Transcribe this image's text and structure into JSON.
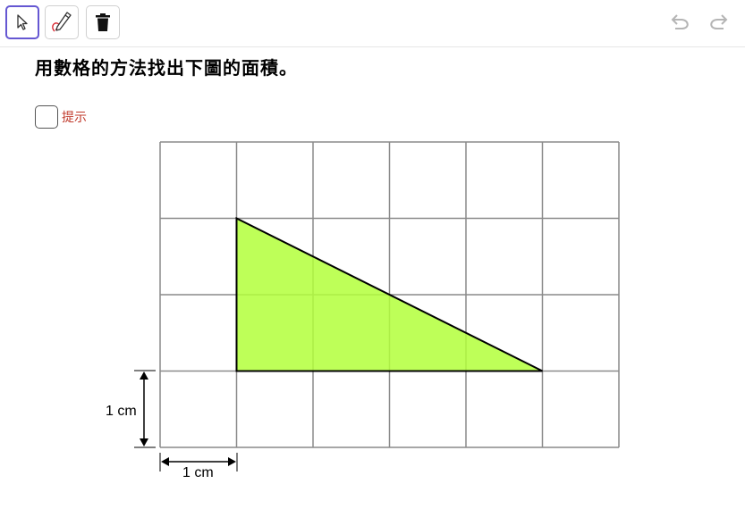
{
  "toolbar": {
    "tools": [
      {
        "name": "move-tool",
        "icon": "cursor-arrow-icon",
        "selected": true
      },
      {
        "name": "pen-tool",
        "icon": "pen-icon",
        "selected": false
      },
      {
        "name": "delete-tool",
        "icon": "trash-icon",
        "selected": false
      }
    ],
    "undo_icon": "undo-icon",
    "redo_icon": "redo-icon"
  },
  "question": "用數格的方法找出下圖的面積。",
  "hint": {
    "label": "提示",
    "checked": false
  },
  "figure": {
    "grid": {
      "columns": 6,
      "rows": 4
    },
    "triangle_vertices": [
      [
        1,
        1
      ],
      [
        1,
        3
      ],
      [
        5,
        3
      ]
    ],
    "fill_color": "#b3ff3b",
    "vertical_dimension_label": "1 cm",
    "horizontal_dimension_label": "1 cm"
  }
}
